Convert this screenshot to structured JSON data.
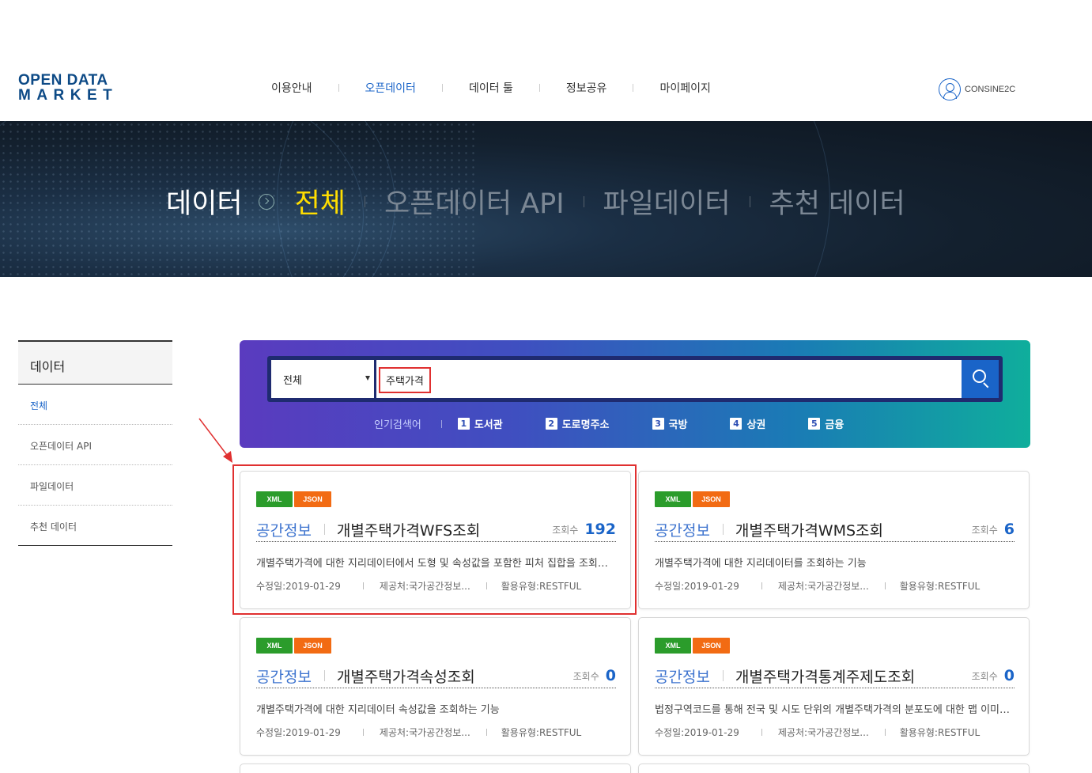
{
  "header": {
    "logo_line1": "OPEN DATA",
    "logo_line2": "MARKET",
    "nav": [
      "이용안내",
      "오픈데이터",
      "데이터 툴",
      "정보공유",
      "마이페이지"
    ],
    "nav_active": 1,
    "user_name": "CONSINE2C"
  },
  "banner": {
    "title": "데이터",
    "items": [
      "전체",
      "오픈데이터 API",
      "파일데이터",
      "추천 데이터"
    ],
    "active_color": "#ffde00"
  },
  "sidebar": {
    "title": "데이터",
    "items": [
      "전체",
      "오픈데이터 API",
      "파일데이터",
      "추천 데이터"
    ]
  },
  "search": {
    "category": "전체",
    "query": "주택가격",
    "popular_label": "인기검색어",
    "keywords": [
      {
        "num": "1",
        "text": "도서관"
      },
      {
        "num": "2",
        "text": "도로명주소"
      },
      {
        "num": "3",
        "text": "국방"
      },
      {
        "num": "4",
        "text": "상권"
      },
      {
        "num": "5",
        "text": "금융"
      }
    ]
  },
  "cards": [
    {
      "tag1": "XML",
      "tag2": "JSON",
      "category": "공간정보",
      "title": "개별주택가격WFS조회",
      "views_label": "조회수",
      "views": "192",
      "desc": "개별주택가격에 대한 지리데이터에서 도형 및 속성값을 포함한 피처 집합을 조회하는 기능",
      "modified": "수정일:2019-01-29",
      "provider": "제공처:국가공간정보...",
      "type": "활용유형:RESTFUL"
    },
    {
      "tag1": "XML",
      "tag2": "JSON",
      "category": "공간정보",
      "title": "개별주택가격WMS조회",
      "views_label": "조회수",
      "views": "6",
      "desc": "개별주택가격에 대한 지리데이터를 조회하는 기능",
      "modified": "수정일:2019-01-29",
      "provider": "제공처:국가공간정보...",
      "type": "활용유형:RESTFUL"
    },
    {
      "tag1": "XML",
      "tag2": "JSON",
      "category": "공간정보",
      "title": "개별주택가격속성조회",
      "views_label": "조회수",
      "views": "0",
      "desc": "개별주택가격에 대한 지리데이터 속성값을 조회하는 기능",
      "modified": "수정일:2019-01-29",
      "provider": "제공처:국가공간정보...",
      "type": "활용유형:RESTFUL"
    },
    {
      "tag1": "XML",
      "tag2": "JSON",
      "category": "공간정보",
      "title": "개별주택가격통계주제도조회",
      "views_label": "조회수",
      "views": "0",
      "desc": "법정구역코드를 통해 전국 및 시도 단위의 개별주택가격의 분포도에 대한 맵 이미지를 조회하는 기능",
      "modified": "수정일:2019-01-29",
      "provider": "제공처:국가공간정보...",
      "type": "활용유형:RESTFUL"
    }
  ],
  "colors": {
    "brand": "#0d4a86",
    "accent": "#1a64c8",
    "highlight": "#e03030",
    "xml_tag": "#2b9c2b",
    "json_tag": "#f26b13"
  }
}
